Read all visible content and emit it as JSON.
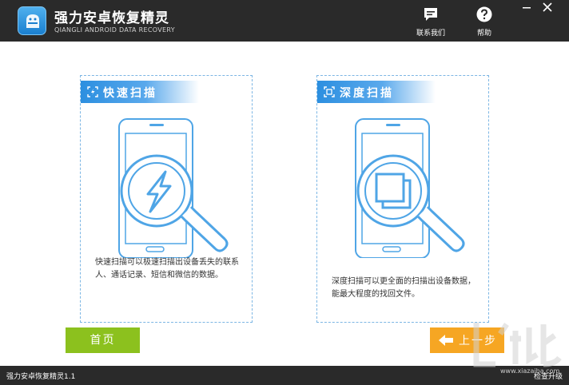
{
  "header": {
    "title": "强力安卓恢复精灵",
    "subtitle": "QIANGLI ANDROID DATA RECOVERY",
    "contact_label": "联系我们",
    "help_label": "帮助",
    "minimize_label": "—",
    "close_label": "✕"
  },
  "panels": {
    "quick": {
      "title": "快速扫描",
      "description": "快速扫描可以极速扫描出设备丢失的联系人、通话记录、短信和微信的数据。"
    },
    "deep": {
      "title": "深度扫描",
      "description": "深度扫描可以更全面的扫描出设备数据，能最大程度的找回文件。"
    }
  },
  "buttons": {
    "home_label": "首页",
    "prev_label": "上一步"
  },
  "statusbar": {
    "version": "强力安卓恢复精灵1.1",
    "upgrade": "检查升级"
  },
  "watermark": {
    "url": "www.xiazaiba.com"
  },
  "colors": {
    "titlebar": "#2a2a2a",
    "accent_blue": "#2c8fe0",
    "home_green": "#8cc11e",
    "prev_orange": "#f6a623"
  }
}
